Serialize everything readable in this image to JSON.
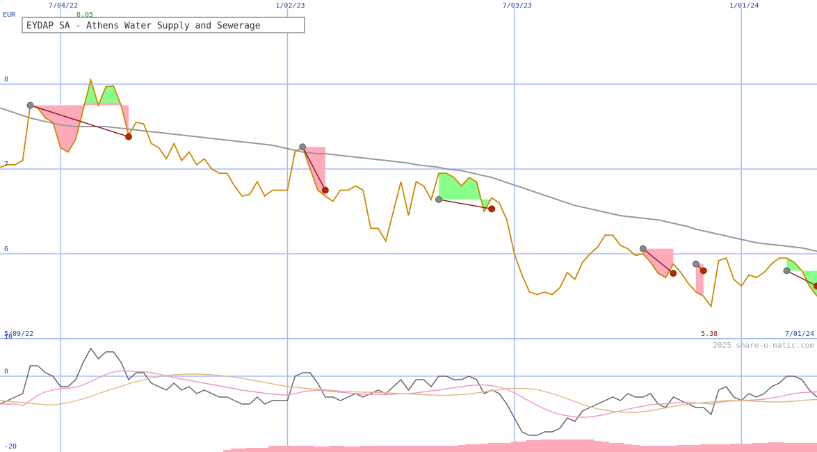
{
  "chart_data": [
    {
      "type": "line",
      "title": "EYDAP SA - Athens Water Supply and Sewerage",
      "currency": "EUR",
      "max_label": "8.05",
      "min_label": "5.38",
      "start_date": "5/09/22",
      "end_date": "7/01/24",
      "ylim": [
        5.0,
        8.3
      ],
      "y_ticks": [
        {
          "value": 8,
          "label": "8"
        },
        {
          "value": 7,
          "label": "7"
        },
        {
          "value": 6,
          "label": "6"
        }
      ],
      "x_ticks": [
        {
          "week": 8,
          "label": "7/04/22"
        },
        {
          "week": 38,
          "label": "1/02/23"
        },
        {
          "week": 68,
          "label": "7/03/23"
        },
        {
          "week": 98,
          "label": "1/01/24"
        }
      ],
      "grid": true,
      "series": [
        {
          "role": "price",
          "color": "#cc8800",
          "values": [
            7.02,
            7.05,
            7.05,
            7.1,
            7.75,
            7.72,
            7.6,
            7.55,
            7.25,
            7.2,
            7.35,
            7.7,
            8.05,
            7.75,
            7.97,
            7.98,
            7.75,
            7.4,
            7.55,
            7.53,
            7.3,
            7.25,
            7.12,
            7.3,
            7.1,
            7.2,
            7.05,
            7.12,
            7.0,
            6.95,
            6.95,
            6.8,
            6.68,
            6.7,
            6.85,
            6.68,
            6.75,
            6.75,
            6.75,
            7.2,
            7.26,
            7.0,
            6.75,
            6.68,
            6.62,
            6.75,
            6.75,
            6.8,
            6.75,
            6.3,
            6.3,
            6.15,
            6.5,
            6.85,
            6.45,
            6.85,
            6.8,
            6.64,
            6.95,
            6.95,
            6.9,
            6.8,
            6.9,
            6.85,
            6.5,
            6.66,
            6.6,
            6.4,
            6.0,
            5.75,
            5.55,
            5.52,
            5.55,
            5.52,
            5.6,
            5.78,
            5.7,
            5.9,
            6.0,
            6.08,
            6.22,
            6.22,
            6.1,
            6.06,
            5.98,
            6.0,
            5.9,
            5.77,
            5.72,
            5.88,
            5.78,
            5.65,
            5.55,
            5.5,
            5.38,
            5.92,
            5.95,
            5.7,
            5.62,
            5.75,
            5.72,
            5.78,
            5.88,
            5.95,
            5.95,
            5.9,
            5.8,
            5.62,
            5.5
          ]
        },
        {
          "role": "moving-average",
          "color": "#999999",
          "values": [
            7.72,
            7.69,
            7.66,
            7.63,
            7.6,
            7.58,
            7.56,
            7.54,
            7.52,
            7.51,
            7.5,
            7.5,
            7.5,
            7.5,
            7.5,
            7.49,
            7.48,
            7.47,
            7.46,
            7.45,
            7.44,
            7.43,
            7.42,
            7.41,
            7.4,
            7.39,
            7.38,
            7.37,
            7.36,
            7.35,
            7.34,
            7.33,
            7.32,
            7.31,
            7.3,
            7.29,
            7.28,
            7.26,
            7.24,
            7.22,
            7.2,
            7.19,
            7.18,
            7.18,
            7.17,
            7.16,
            7.15,
            7.14,
            7.13,
            7.12,
            7.11,
            7.1,
            7.09,
            7.08,
            7.07,
            7.05,
            7.04,
            7.03,
            7.02,
            7.0,
            6.99,
            6.98,
            6.96,
            6.94,
            6.92,
            6.9,
            6.87,
            6.84,
            6.81,
            6.78,
            6.75,
            6.72,
            6.69,
            6.66,
            6.63,
            6.6,
            6.57,
            6.55,
            6.53,
            6.51,
            6.49,
            6.47,
            6.45,
            6.44,
            6.43,
            6.42,
            6.41,
            6.4,
            6.38,
            6.36,
            6.34,
            6.32,
            6.29,
            6.27,
            6.25,
            6.23,
            6.21,
            6.19,
            6.17,
            6.15,
            6.13,
            6.12,
            6.11,
            6.1,
            6.09,
            6.08,
            6.07,
            6.05,
            6.03
          ]
        }
      ],
      "signals": [
        {
          "from": [
            4,
            7.75
          ],
          "to": [
            17,
            7.38
          ],
          "fill": "#ffaabb"
        },
        {
          "from": [
            11,
            7.78
          ],
          "to": [
            16,
            7.78
          ],
          "fill": "#88ff88"
        },
        {
          "from": [
            40,
            7.26
          ],
          "to": [
            43,
            6.75
          ],
          "fill": "#ffaabb"
        },
        {
          "from": [
            58,
            6.64
          ],
          "to": [
            65,
            6.53
          ],
          "fill": "#88ff88"
        },
        {
          "from": [
            85,
            6.06
          ],
          "to": [
            89,
            5.77
          ],
          "fill": "#ffaabb"
        },
        {
          "from": [
            92,
            5.88
          ],
          "to": [
            93,
            5.8
          ],
          "fill": "#ffaabb"
        },
        {
          "from": [
            104,
            5.8
          ],
          "to": [
            108,
            5.62
          ],
          "fill": "#88ff88"
        }
      ],
      "signal_color": "#882222"
    },
    {
      "type": "line",
      "ylim": [
        -22,
        14
      ],
      "y_ticks": [
        {
          "value": 10,
          "label": "10"
        },
        {
          "value": 0,
          "label": "0"
        },
        {
          "value": -20,
          "label": "-20"
        }
      ],
      "watermark": "2025 share-o-matic.com",
      "series": [
        {
          "role": "oscillator",
          "color": "#666666",
          "values": [
            -8,
            -7,
            -6,
            -5,
            3,
            3,
            1,
            0,
            -3,
            -3,
            -1,
            4,
            8,
            5,
            7,
            7,
            4,
            -1,
            1,
            1,
            -2,
            -3,
            -4,
            -2,
            -4,
            -3,
            -5,
            -4,
            -5,
            -6,
            -6,
            -7,
            -8,
            -8,
            -6,
            -8,
            -7,
            -7,
            -7,
            0,
            1,
            1,
            -2,
            -6,
            -6,
            -7,
            -6,
            -5,
            -6,
            -5,
            -4,
            -5,
            -3,
            -1,
            -4,
            -1,
            -1,
            -3,
            0,
            0,
            -1,
            -1,
            0,
            -1,
            -5,
            -4,
            -5,
            -8,
            -12,
            -16,
            -17,
            -17,
            -16,
            -16,
            -15,
            -12,
            -13,
            -10,
            -9,
            -8,
            -7,
            -6,
            -7,
            -5,
            -6,
            -6,
            -5,
            -8,
            -9,
            -6,
            -7,
            -8,
            -9,
            -9,
            -11,
            -4,
            -3,
            -6,
            -7,
            -5,
            -6,
            -5,
            -3,
            -2,
            0,
            0,
            -1,
            -4,
            -6
          ]
        },
        {
          "role": "signal-line",
          "color": "#ee99bb",
          "values": [
            -8,
            -8,
            -8,
            -8.5,
            -7,
            -5.5,
            -4.5,
            -4,
            -3.5,
            -3.5,
            -3.2,
            -2.5,
            -1.5,
            -0.5,
            0.5,
            1.2,
            1.5,
            1.5,
            1.4,
            1.3,
            1,
            0.6,
            0.1,
            -0.4,
            -0.8,
            -1.2,
            -1.6,
            -2,
            -2.4,
            -2.8,
            -3.2,
            -3.6,
            -4,
            -4.3,
            -4.6,
            -4.9,
            -5.1,
            -5.3,
            -5.4,
            -5,
            -4.5,
            -4.2,
            -4,
            -4.2,
            -4.4,
            -4.6,
            -4.8,
            -5,
            -5.2,
            -5.2,
            -5.2,
            -5.3,
            -5.2,
            -5,
            -5,
            -4.8,
            -4.5,
            -4.2,
            -4,
            -3.6,
            -3.3,
            -3,
            -2.7,
            -2.5,
            -2.5,
            -2.7,
            -3.1,
            -3.8,
            -4.8,
            -6,
            -7.2,
            -8.4,
            -9.4,
            -10.3,
            -11,
            -11.4,
            -11.7,
            -11.8,
            -11.7,
            -11.4,
            -11,
            -10.5,
            -10,
            -9.5,
            -9,
            -8.6,
            -8.2,
            -8,
            -7.9,
            -7.7,
            -7.6,
            -7.6,
            -7.7,
            -7.8,
            -8,
            -7.6,
            -7.2,
            -7.1,
            -7,
            -6.9,
            -6.8,
            -6.6,
            -6.3,
            -5.9,
            -5.4,
            -5,
            -4.7,
            -4.6,
            -4.5
          ]
        },
        {
          "role": "slow-line",
          "color": "#ddbb88",
          "values": [
            -7,
            -7.2,
            -7.4,
            -7.6,
            -7.8,
            -8,
            -8.2,
            -8.3,
            -8,
            -7.6,
            -7.1,
            -6.5,
            -5.8,
            -5,
            -4.3,
            -3.6,
            -2.9,
            -2.2,
            -1.6,
            -1,
            -0.5,
            -0.1,
            0.2,
            0.4,
            0.5,
            0.6,
            0.6,
            0.5,
            0.4,
            0.2,
            0,
            -0.3,
            -0.6,
            -1,
            -1.4,
            -1.8,
            -2.2,
            -2.6,
            -3,
            -3.2,
            -3.4,
            -3.6,
            -3.7,
            -3.9,
            -4.1,
            -4.3,
            -4.4,
            -4.5,
            -4.6,
            -4.6,
            -4.7,
            -4.8,
            -4.9,
            -5,
            -5.1,
            -5.2,
            -5.3,
            -5.4,
            -5.5,
            -5.5,
            -5.4,
            -5.3,
            -5.1,
            -4.8,
            -4.5,
            -4.2,
            -3.9,
            -3.6,
            -3.5,
            -3.5,
            -3.6,
            -3.9,
            -4.4,
            -5,
            -5.7,
            -6.5,
            -7.3,
            -8.1,
            -8.8,
            -9.4,
            -9.8,
            -10.1,
            -10.3,
            -10.4,
            -10.4,
            -10.2,
            -9.9,
            -9.5,
            -9.1,
            -8.7,
            -8.3,
            -8,
            -7.8,
            -7.6,
            -7.4,
            -7.2,
            -7,
            -7,
            -7,
            -7.1,
            -7.2,
            -7.3,
            -7.4,
            -7.4,
            -7.3,
            -7.2,
            -7,
            -6.8,
            -6.7
          ]
        }
      ],
      "volume": {
        "color": "#ffaabb",
        "values": [
          0,
          0,
          0,
          0,
          0,
          0,
          0,
          0,
          0,
          0,
          0,
          0,
          0,
          0,
          0,
          0,
          0,
          0,
          0,
          0,
          0,
          0,
          0,
          0,
          0,
          0,
          0,
          0,
          0,
          0,
          0.3,
          0.5,
          0.5,
          0.6,
          0.6,
          0.6,
          0.9,
          0.9,
          0.9,
          0.9,
          0.9,
          0.9,
          0.8,
          0.8,
          0.9,
          0.9,
          0.8,
          0.8,
          0.9,
          0.9,
          0.9,
          0.9,
          0.9,
          0.9,
          0.9,
          0.9,
          0.9,
          0.9,
          0.9,
          0.9,
          0.9,
          1.0,
          1.1,
          1.1,
          1.2,
          1.3,
          1.3,
          1.3,
          1.5,
          1.5,
          1.7,
          1.7,
          1.8,
          1.8,
          1.8,
          1.8,
          1.8,
          1.8,
          1.8,
          1.6,
          1.5,
          1.3,
          1.3,
          1.1,
          1.0,
          0.9,
          0.9,
          0.9,
          0.9,
          0.9,
          1.0,
          1.0,
          1.0,
          1.1,
          1.1,
          1.1,
          1.1,
          1.2,
          1.2,
          1.2,
          1.3,
          1.3,
          1.4,
          1.4,
          1.3,
          1.3,
          1.3,
          1.3,
          1.3
        ]
      }
    }
  ],
  "colors": {
    "background": "#ffffff",
    "grid": "#aabbff",
    "axis_text": "#2244aa",
    "max_label": "#228822",
    "min_label": "#882222",
    "marker_start": "#888888",
    "marker_end": "#bb2200"
  }
}
